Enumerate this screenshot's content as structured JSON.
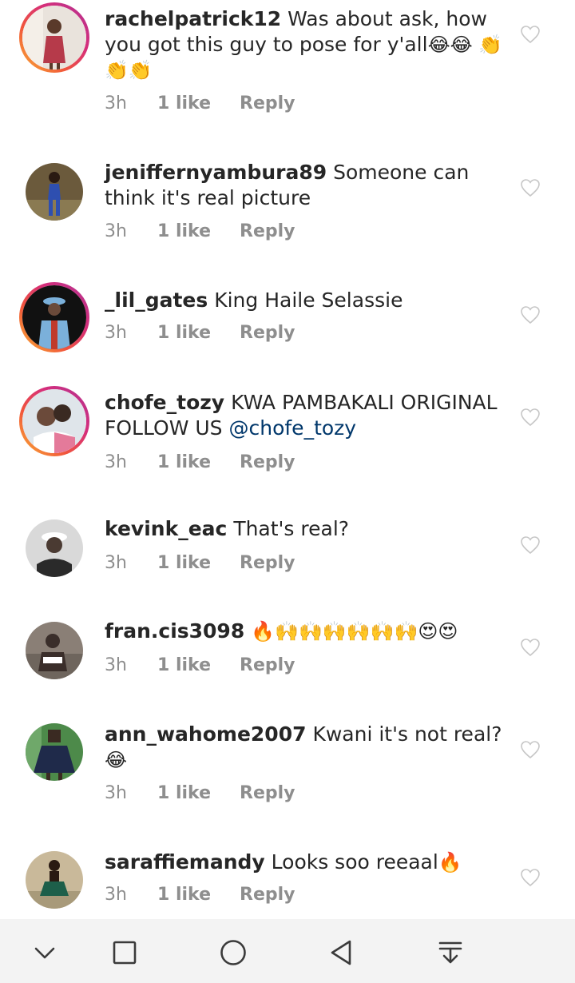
{
  "comments": [
    {
      "username": "rachelpatrick12",
      "text": "Was about ask, how you got this guy to pose for y'all",
      "emoji": "😂😂 👏👏👏",
      "time": "3h",
      "likes": "1 like",
      "reply": "Reply",
      "ring": true,
      "avatar_colors": [
        "#e9e3dc",
        "#b63a4a"
      ]
    },
    {
      "username": "jeniffernyambura89",
      "text": "Someone can think it's real picture",
      "emoji": "",
      "time": "3h",
      "likes": "1 like",
      "reply": "Reply",
      "ring": false,
      "avatar_colors": [
        "#6b5a3c",
        "#2e4fb0"
      ]
    },
    {
      "username": "_lil_gates",
      "text": "King Haile Selassie",
      "emoji": "",
      "time": "3h",
      "likes": "1 like",
      "reply": "Reply",
      "ring": true,
      "avatar_colors": [
        "#111111",
        "#7bb0da"
      ]
    },
    {
      "username": "chofe_tozy",
      "text": "KWA PAMBAKALI ORIGINAL FOLLOW US",
      "mention": "@chofe_tozy",
      "emoji": "",
      "time": "3h",
      "likes": "1 like",
      "reply": "Reply",
      "ring": true,
      "avatar_colors": [
        "#dfe5ea",
        "#6b4a3a"
      ]
    },
    {
      "username": "kevink_eac",
      "text": "That's real?",
      "emoji": "",
      "time": "3h",
      "likes": "1 like",
      "reply": "Reply",
      "ring": false,
      "avatar_colors": [
        "#d9d9d9",
        "#2a2a2a"
      ]
    },
    {
      "username": "fran.cis3098",
      "text": "",
      "emoji": "🔥🙌🙌🙌🙌🙌🙌😍😍",
      "time": "3h",
      "likes": "1 like",
      "reply": "Reply",
      "ring": false,
      "avatar_colors": [
        "#8a7f76",
        "#3a2e2a"
      ]
    },
    {
      "username": "ann_wahome2007",
      "text": "Kwani it's not real?",
      "emoji": "😂",
      "time": "3h",
      "likes": "1 like",
      "reply": "Reply",
      "ring": false,
      "avatar_colors": [
        "#4d8a4a",
        "#1f2a4a"
      ]
    },
    {
      "username": "saraffiemandy",
      "text": "Looks soo reeaal",
      "emoji": "🔥",
      "time": "3h",
      "likes": "1 like",
      "reply": "Reply",
      "ring": false,
      "avatar_colors": [
        "#c9b99a",
        "#1d5f4a"
      ]
    }
  ],
  "navbar": {
    "buttons": [
      "collapse-icon",
      "recent-apps-icon",
      "home-icon",
      "back-icon",
      "notification-pull-icon"
    ],
    "icon_color": "#3a3a3a"
  },
  "colors": {
    "username": "#262626",
    "meta": "#8e8e8e",
    "mention": "#00376b",
    "heart": "#c7c7c7"
  }
}
